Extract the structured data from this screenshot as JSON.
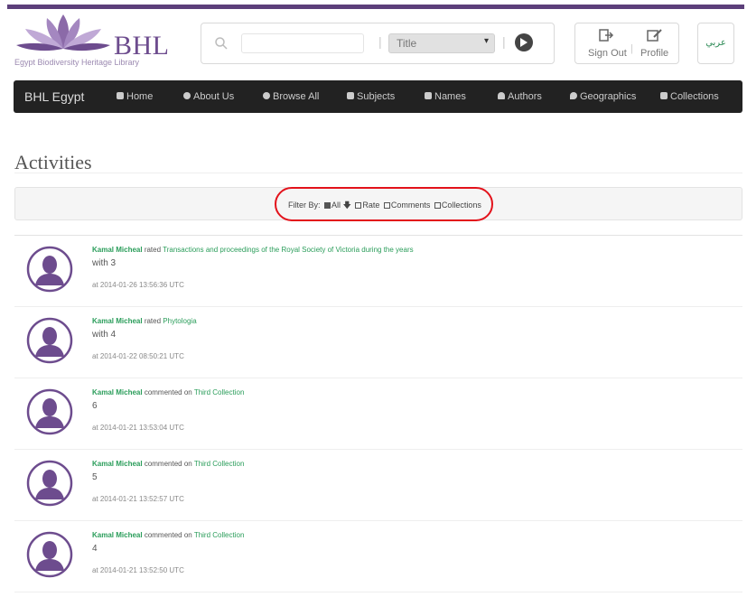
{
  "header": {
    "logo_text": "BHL",
    "logo_subtitle": "Egypt Biodiversity Heritage Library",
    "search_input_value": "",
    "search_field": "Title",
    "sign_out_label": "Sign Out",
    "profile_label": "Profile",
    "language_label": "عربي"
  },
  "nav": {
    "brand": "BHL Egypt",
    "items": [
      "Home",
      "About Us",
      "Browse All",
      "Subjects",
      "Names",
      "Authors",
      "Geographics",
      "Collections"
    ]
  },
  "page": {
    "title": "Activities"
  },
  "filter": {
    "label": "Filter By:",
    "options": [
      {
        "label": "All",
        "checked": true
      },
      {
        "label": "Rate",
        "checked": false
      },
      {
        "label": "Comments",
        "checked": false
      },
      {
        "label": "Collections",
        "checked": false
      }
    ]
  },
  "activities": [
    {
      "user": "Kamal Micheal",
      "action": "rated",
      "target": "Transactions and proceedings of the Royal Society of Victoria during the years",
      "detail": "with 3",
      "time": "at 2014-01-26 13:56:36 UTC"
    },
    {
      "user": "Kamal Micheal",
      "action": "rated",
      "target": "Phytologia",
      "detail": "with 4",
      "time": "at 2014-01-22 08:50:21 UTC"
    },
    {
      "user": "Kamal Micheal",
      "action": "commented on",
      "target": "Third Collection",
      "detail": "6",
      "time": "at 2014-01-21 13:53:04 UTC"
    },
    {
      "user": "Kamal Micheal",
      "action": "commented on",
      "target": "Third Collection",
      "detail": "5",
      "time": "at 2014-01-21 13:52:57 UTC"
    },
    {
      "user": "Kamal Micheal",
      "action": "commented on",
      "target": "Third Collection",
      "detail": "4",
      "time": "at 2014-01-21 13:52:50 UTC"
    }
  ],
  "colors": {
    "brand_purple": "#6d4c8e",
    "link_green": "#2a9d5a",
    "highlight_red": "#e3121b",
    "navbar_bg": "#222222"
  }
}
